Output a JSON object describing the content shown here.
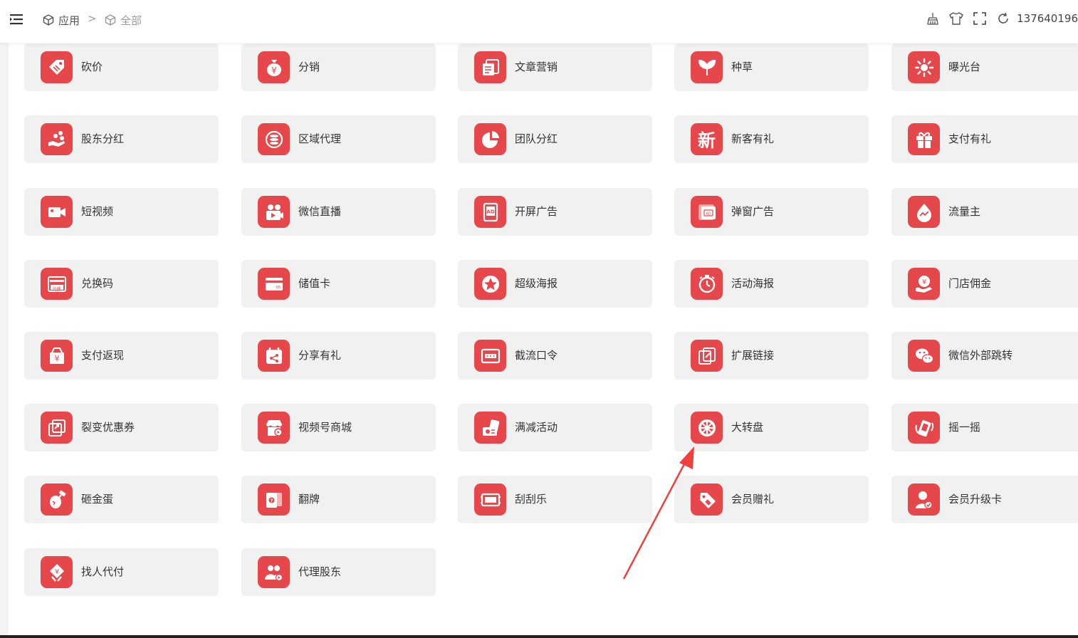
{
  "header": {
    "breadcrumb": [
      "应用",
      "全部"
    ],
    "separator": ">",
    "account": "137640196"
  },
  "colors": {
    "accent": "#e5474b",
    "card_bg": "#f1f1f1",
    "arrow": "#f0403e"
  },
  "apps": [
    {
      "label": "砍价",
      "icon": "tag-icon"
    },
    {
      "label": "分销",
      "icon": "money-bag-icon"
    },
    {
      "label": "文章营销",
      "icon": "article-icon"
    },
    {
      "label": "种草",
      "icon": "sprout-icon"
    },
    {
      "label": "曝光台",
      "icon": "sun-icon"
    },
    {
      "label": "股东分红",
      "icon": "hand-share-icon"
    },
    {
      "label": "区域代理",
      "icon": "coin-stack-icon"
    },
    {
      "label": "团队分红",
      "icon": "pie-icon"
    },
    {
      "label": "新客有礼",
      "icon": "new-char-icon",
      "char": "新"
    },
    {
      "label": "支付有礼",
      "icon": "gift-icon"
    },
    {
      "label": "短视频",
      "icon": "video-camera-icon"
    },
    {
      "label": "微信直播",
      "icon": "live-icon"
    },
    {
      "label": "开屏广告",
      "icon": "ad-phone-icon"
    },
    {
      "label": "弹窗广告",
      "icon": "ad-popup-icon"
    },
    {
      "label": "流量主",
      "icon": "flow-drop-icon"
    },
    {
      "label": "兑换码",
      "icon": "redeem-card-icon",
      "char": "兑换"
    },
    {
      "label": "储值卡",
      "icon": "stored-card-icon"
    },
    {
      "label": "超级海报",
      "icon": "star-badge-icon"
    },
    {
      "label": "活动海报",
      "icon": "stopwatch-icon"
    },
    {
      "label": "门店佣金",
      "icon": "hand-coin-icon"
    },
    {
      "label": "支付返现",
      "icon": "cash-bag-icon"
    },
    {
      "label": "分享有礼",
      "icon": "share-calendar-icon"
    },
    {
      "label": "截流口令",
      "icon": "password-icon"
    },
    {
      "label": "扩展链接",
      "icon": "link-icon"
    },
    {
      "label": "微信外部跳转",
      "icon": "wechat-icon"
    },
    {
      "label": "裂变优惠券",
      "icon": "fission-coupon-icon"
    },
    {
      "label": "视频号商城",
      "icon": "shop-icon"
    },
    {
      "label": "满减活动",
      "icon": "discount-icon"
    },
    {
      "label": "大转盘",
      "icon": "wheel-icon"
    },
    {
      "label": "摇一摇",
      "icon": "shake-phone-icon"
    },
    {
      "label": "砸金蛋",
      "icon": "egg-hammer-icon"
    },
    {
      "label": "翻牌",
      "icon": "flip-card-icon"
    },
    {
      "label": "刮刮乐",
      "icon": "scratch-card-icon"
    },
    {
      "label": "会员赠礼",
      "icon": "member-tag-icon"
    },
    {
      "label": "会员升级卡",
      "icon": "member-upgrade-icon"
    },
    {
      "label": "找人代付",
      "icon": "pay-for-me-icon"
    },
    {
      "label": "代理股东",
      "icon": "agent-group-icon"
    }
  ]
}
